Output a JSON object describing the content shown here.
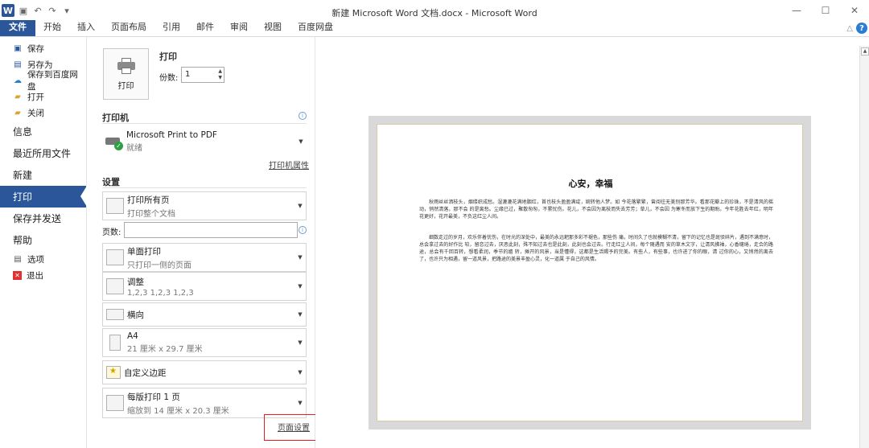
{
  "window": {
    "title": "新建 Microsoft Word 文档.docx - Microsoft Word",
    "app_logo": "W",
    "min": "—",
    "max": "☐",
    "close": "✕"
  },
  "ribbon": {
    "tabs": [
      "文件",
      "开始",
      "插入",
      "页面布局",
      "引用",
      "邮件",
      "审阅",
      "视图",
      "百度网盘"
    ]
  },
  "nav": {
    "small_top": [
      {
        "label": "保存",
        "icon": "save-icon"
      },
      {
        "label": "另存为",
        "icon": "save-as-icon"
      },
      {
        "label": "保存到百度网盘",
        "icon": "baidu-cloud-icon"
      },
      {
        "label": "打开",
        "icon": "open-folder-icon"
      },
      {
        "label": "关闭",
        "icon": "close-folder-icon"
      }
    ],
    "big": [
      "信息",
      "最近所用文件",
      "新建",
      "打印",
      "保存并发送",
      "帮助"
    ],
    "small_bottom": [
      {
        "label": "选项",
        "icon": "options-icon"
      },
      {
        "label": "退出",
        "icon": "exit-icon"
      }
    ]
  },
  "print": {
    "heading": "打印",
    "button_label": "打印",
    "copies_label": "份数:",
    "copies_value": "1",
    "printer_section": "打印机",
    "printer_name": "Microsoft Print to PDF",
    "printer_status": "就绪",
    "printer_props_link": "打印机属性",
    "settings_section": "设置",
    "settings": [
      {
        "main": "打印所有页",
        "sub": "打印整个文档"
      },
      {
        "main": "单面打印",
        "sub": "只打印一侧的页面"
      },
      {
        "main": "调整",
        "sub": "1,2,3   1,2,3   1,2,3"
      },
      {
        "main": "横向",
        "sub": ""
      },
      {
        "main": "A4",
        "sub": "21 厘米 x 29.7 厘米"
      },
      {
        "main": "自定义边距",
        "sub": ""
      },
      {
        "main": "每版打印 1 页",
        "sub": "缩放到 14 厘米 x 20.3 厘米"
      }
    ],
    "pages_label": "页数:",
    "page_setup_link": "页面设置"
  },
  "document": {
    "title": "心安，幸福",
    "paragraph1": "秋雨丝丝洒枝头，烟缕织成愁。湿漉漉花满地胭红，首也枝头盈盈满绽，婉转他人梦。如 今花落繁繁，曾阅往无美别那芳华。看那花瓣上的珍珠，不是清风的摇动，悄然清落，那不会 的是离愁。尘缘已过，聚散匆匆，不累忧伤。花儿，不会因为离枝而失去芳芳；草儿，不会因 为寒冬而放下生的期盼。今年花胜去年红，明年花更好，花开最美，不负这红尘人间。",
    "paragraph2": "细数走过的岁月，欢乐伴着忧伤，在时光的深处中，最美的永远耙那多彩不褪色，那些伤 痛，时间久了也就模糊不清，留下的记忆也是斑驳碎片，遇到不满意时，总会拿过去的好作比 较，留恋过去，厌恶此刻，殊不知过去也是此刻，此刻也会过去。行走红尘人间，每个随遇而 安的草木文字，让清风拂袖，心香缱绻，走合的路途，总会有千回百转，想看柔润，季节的嬗 转，摊开的风景，当是懂得，这都是生活赐予的完美。有些人，有些事，也许进了你的眼，清 过你的心，又悄然的离去了，也许只为相遇，留一道风景，把路途的美景丰盈心灵，化一道属 于自己的风情。"
  },
  "colors": {
    "accent": "#2b579a",
    "highlight": "#e02020"
  }
}
